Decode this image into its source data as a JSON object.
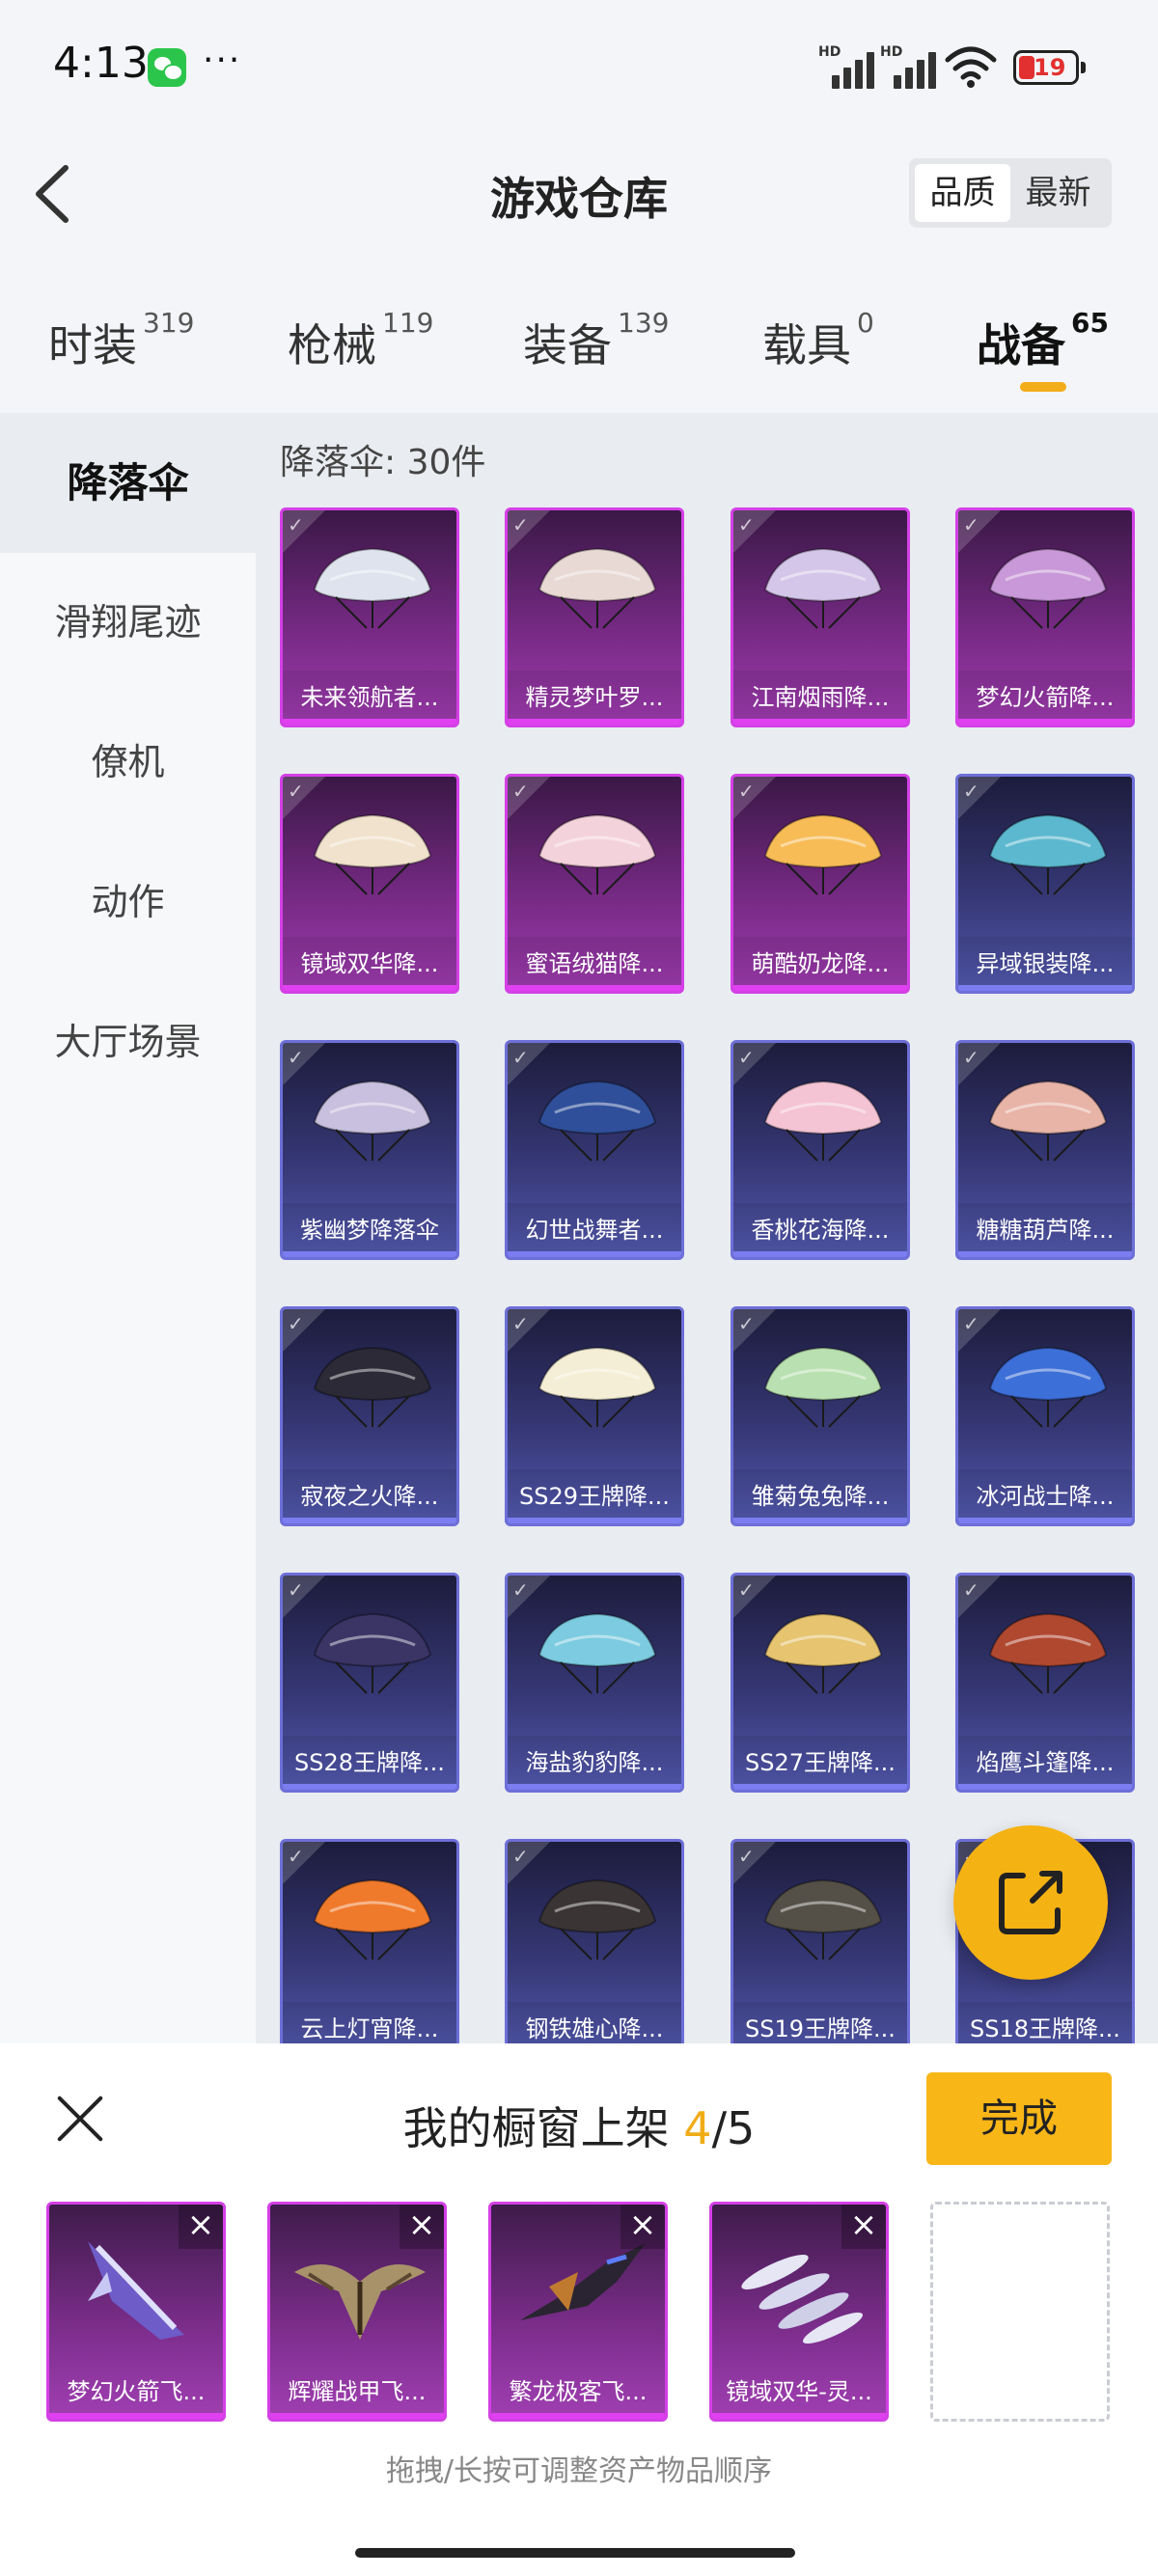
{
  "status_bar": {
    "time": "4:13",
    "more": "···",
    "battery": "19",
    "sig1": "HD",
    "sig2": "HD"
  },
  "header": {
    "title": "游戏仓库",
    "sort": [
      "品质",
      "最新"
    ]
  },
  "tabs": [
    {
      "label": "时装",
      "count": "319"
    },
    {
      "label": "枪械",
      "count": "119"
    },
    {
      "label": "装备",
      "count": "139"
    },
    {
      "label": "载具",
      "count": "0"
    },
    {
      "label": "战备",
      "count": "65"
    }
  ],
  "sidebar": [
    "降落伞",
    "滑翔尾迹",
    "僚机",
    "动作",
    "大厅场景"
  ],
  "grid": {
    "count_label": "降落伞: 30件",
    "items": [
      {
        "name": "未来领航者...",
        "rarity": "purple",
        "color": "#dfe3ee"
      },
      {
        "name": "精灵梦叶罗...",
        "rarity": "purple",
        "color": "#e8d9d4"
      },
      {
        "name": "江南烟雨降...",
        "rarity": "purple",
        "color": "#d4c6e8"
      },
      {
        "name": "梦幻火箭降...",
        "rarity": "purple",
        "color": "#c898d8"
      },
      {
        "name": "镜域双华降...",
        "rarity": "purple",
        "color": "#f0e2cc"
      },
      {
        "name": "蜜语绒猫降...",
        "rarity": "purple",
        "color": "#f4d2dc"
      },
      {
        "name": "萌酷奶龙降...",
        "rarity": "purple",
        "color": "#f7bc56"
      },
      {
        "name": "异域银装降...",
        "rarity": "blue",
        "color": "#5cb8cf"
      },
      {
        "name": "紫幽梦降落伞",
        "rarity": "blue",
        "color": "#c8c0de"
      },
      {
        "name": "幻世战舞者...",
        "rarity": "blue",
        "color": "#2f4f9a"
      },
      {
        "name": "香桃花海降...",
        "rarity": "blue",
        "color": "#f4c4d4"
      },
      {
        "name": "糖糖葫芦降...",
        "rarity": "blue",
        "color": "#e8b4a8"
      },
      {
        "name": "寂夜之火降...",
        "rarity": "blue",
        "color": "#2b2a36"
      },
      {
        "name": "SS29王牌降...",
        "rarity": "blue",
        "color": "#f4eed6"
      },
      {
        "name": "雏菊兔兔降...",
        "rarity": "blue",
        "color": "#b8e0b0"
      },
      {
        "name": "冰河战士降...",
        "rarity": "blue",
        "color": "#3d6fd8"
      },
      {
        "name": "SS28王牌降...",
        "rarity": "blue",
        "color": "#3b3566"
      },
      {
        "name": "海盐豹豹降...",
        "rarity": "blue",
        "color": "#7ccbe0"
      },
      {
        "name": "SS27王牌降...",
        "rarity": "blue",
        "color": "#e6c470"
      },
      {
        "name": "焰鹰斗篷降...",
        "rarity": "blue",
        "color": "#b04830"
      },
      {
        "name": "云上灯宵降...",
        "rarity": "blue",
        "color": "#f07a2c"
      },
      {
        "name": "钢铁雄心降...",
        "rarity": "blue",
        "color": "#3a3434"
      },
      {
        "name": "SS19王牌降...",
        "rarity": "blue",
        "color": "#555047"
      },
      {
        "name": "SS18王牌降...",
        "rarity": "blue",
        "color": "#444a7a"
      }
    ]
  },
  "panel": {
    "title_prefix": "我的橱窗上架 ",
    "count_current": "4",
    "count_total": "/5",
    "done_label": "完成",
    "slots": [
      {
        "name": "梦幻火箭飞..."
      },
      {
        "name": "辉耀战甲飞..."
      },
      {
        "name": "繁龙极客飞..."
      },
      {
        "name": "镜域双华-灵..."
      }
    ],
    "hint": "拖拽/长按可调整资产物品顺序"
  },
  "colors": {
    "accent": "#f5b213",
    "purple_border": "#d440e6",
    "blue_border": "#6d6fd8"
  }
}
